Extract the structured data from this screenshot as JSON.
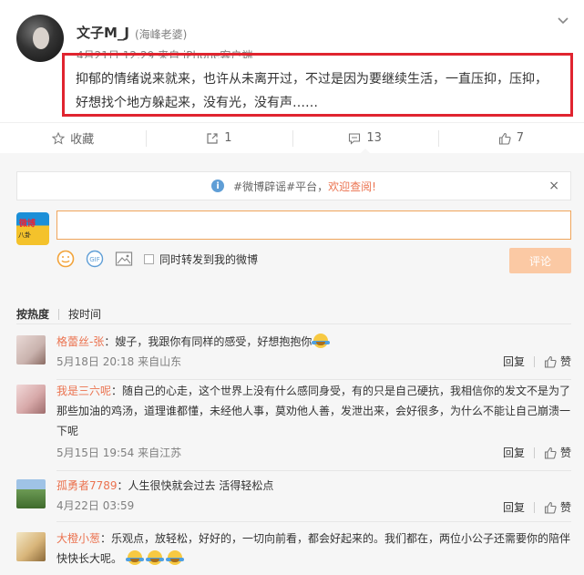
{
  "post": {
    "username": "文子M_J",
    "user_tag": "(海峰老婆)",
    "meta": "4月21日 12:29 来自 iPhone客户端",
    "content": "抑郁的情绪说来就来，也许从未离开过，不过是因为要继续生活，一直压抑，压抑，好想找个地方躲起来，没有光，没有声……"
  },
  "actions": [
    {
      "label": "收藏",
      "icon": "star-icon"
    },
    {
      "label": "1",
      "icon": "share-icon"
    },
    {
      "label": "13",
      "icon": "comment-icon"
    },
    {
      "label": "7",
      "icon": "like-icon"
    }
  ],
  "notice": {
    "text": "#微博辟谣#平台，",
    "link": "欢迎查阅!",
    "close": "×"
  },
  "composer": {
    "avatar_text": "微博",
    "avatar_sub": "八卦",
    "forward_label": "同时转发到我的微博",
    "submit_label": "评论"
  },
  "sort": {
    "hot": "按热度",
    "time": "按时间"
  },
  "comments": [
    {
      "name": "格蕾丝-张",
      "text": "：嫂子，我跟你有同样的感受，好想抱抱你",
      "emoji_count": 1,
      "time": "5月18日 20:18 来自山东",
      "reply": "回复",
      "like": "赞"
    },
    {
      "name": "我是三六呢",
      "text": "：随自己的心走，这个世界上没有什么感同身受，有的只是自己硬抗，我相信你的发文不是为了那些加油的鸡汤，道理谁都懂，未经他人事，莫劝他人善，发泄出来，会好很多，为什么不能让自己崩溃一下呢",
      "emoji_count": 0,
      "time": "5月15日 19:54 来自江苏",
      "reply": "回复",
      "like": "赞"
    },
    {
      "name": "孤勇者7789",
      "text": "：人生很快就会过去 活得轻松点",
      "emoji_count": 0,
      "time": "4月22日 03:59",
      "reply": "回复",
      "like": "赞"
    },
    {
      "name": "大橙小葱",
      "text": "：乐观点，放轻松，好好的，一切向前看，都会好起来的。我们都在，两位小公子还需要你的陪伴快快长大呢。",
      "emoji_count": 3,
      "time": "",
      "reply": "",
      "like": ""
    }
  ],
  "colors": {
    "highlight_border": "#e0242f",
    "link": "#eb7350",
    "submit_disabled": "#fbc9a4"
  }
}
